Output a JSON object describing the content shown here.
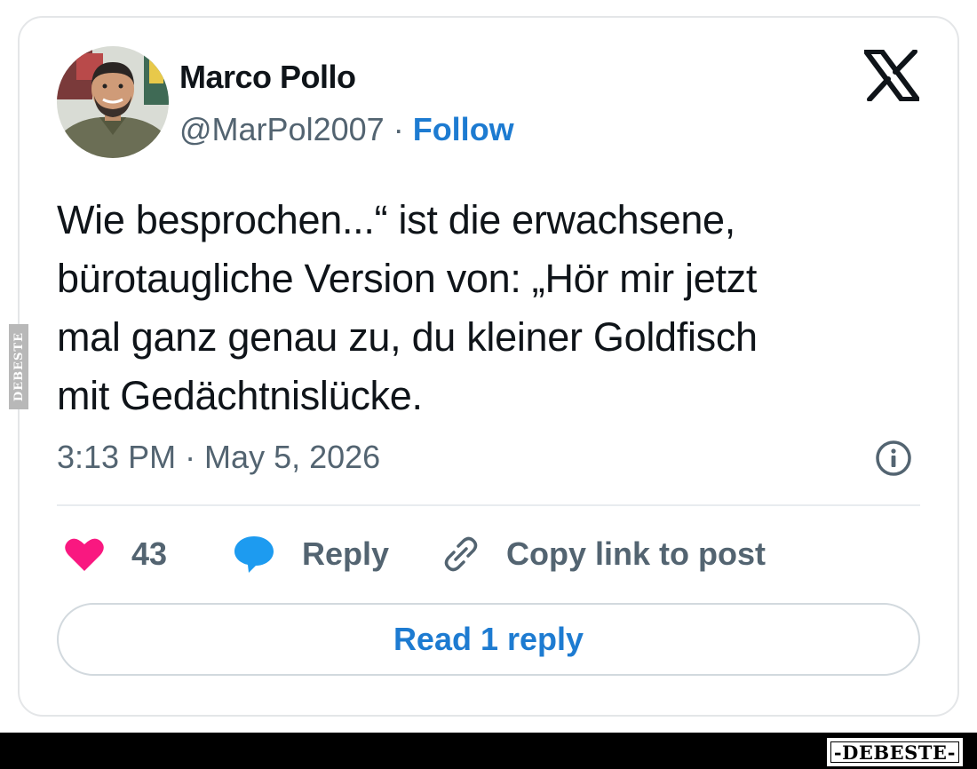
{
  "post": {
    "author_name": "Marco Pollo",
    "handle": "@MarPol2007",
    "separator": "·",
    "follow_label": "Follow",
    "text": "Wie besprochen...“ ist die erwachsene,\nbürotaugliche Version von: „Hör mir jetzt\nmal ganz genau zu, du kleiner Goldfisch\nmit Gedächtnislücke.",
    "timestamp": "3:13 PM · May 5, 2026",
    "like_count": "43",
    "reply_label": "Reply",
    "copy_link_label": "Copy link to post",
    "read_replies_label": "Read 1 reply"
  },
  "icons": {
    "platform_logo": "x-logo-icon",
    "info": "info-icon",
    "like": "heart-icon",
    "reply": "speech-bubble-icon",
    "copy": "link-icon"
  },
  "colors": {
    "text": "#0f1419",
    "secondary_text": "#536471",
    "accent": "#1d7bd1",
    "like": "#f91880",
    "reply_icon": "#1d9bf0"
  },
  "watermark": {
    "side_text": "DEBESTE",
    "bottom_text": "-DEBESTE-"
  }
}
